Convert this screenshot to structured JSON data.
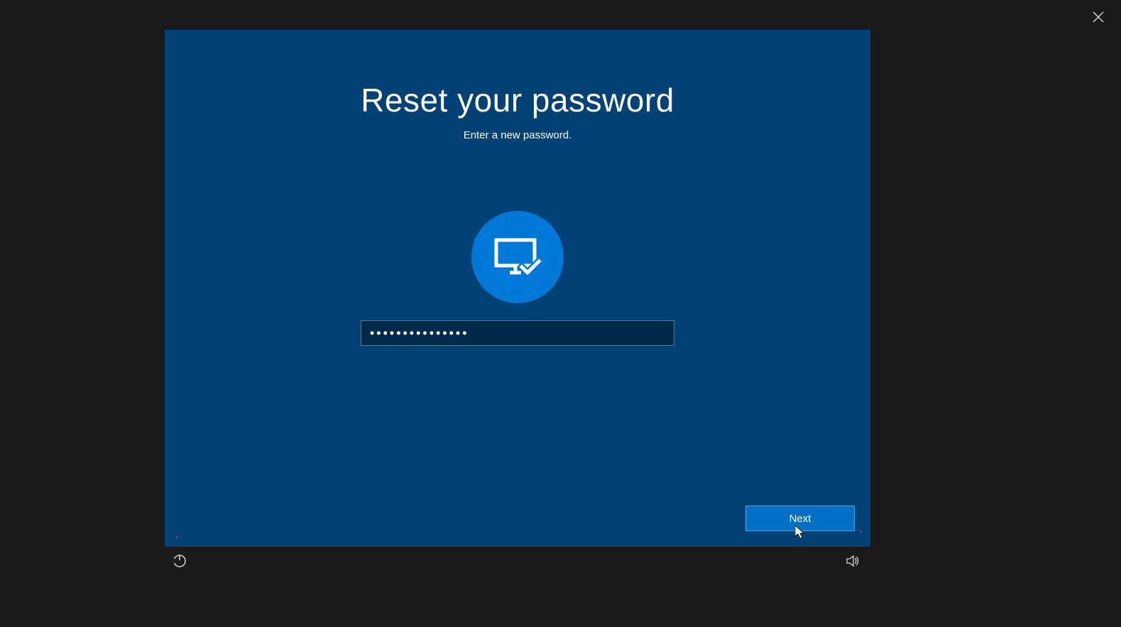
{
  "header": {
    "title": "Reset your password",
    "subtitle": "Enter a new password."
  },
  "form": {
    "password_value": "•••••••••••••••"
  },
  "actions": {
    "next_label": "Next"
  }
}
